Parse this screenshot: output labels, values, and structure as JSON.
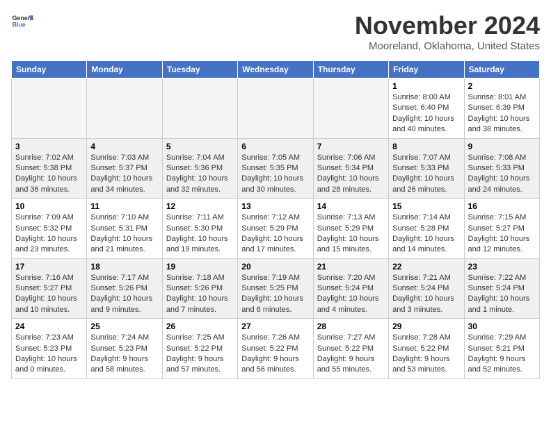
{
  "header": {
    "logo_line1": "General",
    "logo_line2": "Blue",
    "month": "November 2024",
    "location": "Mooreland, Oklahoma, United States"
  },
  "weekdays": [
    "Sunday",
    "Monday",
    "Tuesday",
    "Wednesday",
    "Thursday",
    "Friday",
    "Saturday"
  ],
  "weeks": [
    [
      {
        "day": "",
        "info": ""
      },
      {
        "day": "",
        "info": ""
      },
      {
        "day": "",
        "info": ""
      },
      {
        "day": "",
        "info": ""
      },
      {
        "day": "",
        "info": ""
      },
      {
        "day": "1",
        "info": "Sunrise: 8:00 AM\nSunset: 6:40 PM\nDaylight: 10 hours\nand 40 minutes."
      },
      {
        "day": "2",
        "info": "Sunrise: 8:01 AM\nSunset: 6:39 PM\nDaylight: 10 hours\nand 38 minutes."
      }
    ],
    [
      {
        "day": "3",
        "info": "Sunrise: 7:02 AM\nSunset: 5:38 PM\nDaylight: 10 hours\nand 36 minutes."
      },
      {
        "day": "4",
        "info": "Sunrise: 7:03 AM\nSunset: 5:37 PM\nDaylight: 10 hours\nand 34 minutes."
      },
      {
        "day": "5",
        "info": "Sunrise: 7:04 AM\nSunset: 5:36 PM\nDaylight: 10 hours\nand 32 minutes."
      },
      {
        "day": "6",
        "info": "Sunrise: 7:05 AM\nSunset: 5:35 PM\nDaylight: 10 hours\nand 30 minutes."
      },
      {
        "day": "7",
        "info": "Sunrise: 7:06 AM\nSunset: 5:34 PM\nDaylight: 10 hours\nand 28 minutes."
      },
      {
        "day": "8",
        "info": "Sunrise: 7:07 AM\nSunset: 5:33 PM\nDaylight: 10 hours\nand 26 minutes."
      },
      {
        "day": "9",
        "info": "Sunrise: 7:08 AM\nSunset: 5:33 PM\nDaylight: 10 hours\nand 24 minutes."
      }
    ],
    [
      {
        "day": "10",
        "info": "Sunrise: 7:09 AM\nSunset: 5:32 PM\nDaylight: 10 hours\nand 23 minutes."
      },
      {
        "day": "11",
        "info": "Sunrise: 7:10 AM\nSunset: 5:31 PM\nDaylight: 10 hours\nand 21 minutes."
      },
      {
        "day": "12",
        "info": "Sunrise: 7:11 AM\nSunset: 5:30 PM\nDaylight: 10 hours\nand 19 minutes."
      },
      {
        "day": "13",
        "info": "Sunrise: 7:12 AM\nSunset: 5:29 PM\nDaylight: 10 hours\nand 17 minutes."
      },
      {
        "day": "14",
        "info": "Sunrise: 7:13 AM\nSunset: 5:29 PM\nDaylight: 10 hours\nand 15 minutes."
      },
      {
        "day": "15",
        "info": "Sunrise: 7:14 AM\nSunset: 5:28 PM\nDaylight: 10 hours\nand 14 minutes."
      },
      {
        "day": "16",
        "info": "Sunrise: 7:15 AM\nSunset: 5:27 PM\nDaylight: 10 hours\nand 12 minutes."
      }
    ],
    [
      {
        "day": "17",
        "info": "Sunrise: 7:16 AM\nSunset: 5:27 PM\nDaylight: 10 hours\nand 10 minutes."
      },
      {
        "day": "18",
        "info": "Sunrise: 7:17 AM\nSunset: 5:26 PM\nDaylight: 10 hours\nand 9 minutes."
      },
      {
        "day": "19",
        "info": "Sunrise: 7:18 AM\nSunset: 5:26 PM\nDaylight: 10 hours\nand 7 minutes."
      },
      {
        "day": "20",
        "info": "Sunrise: 7:19 AM\nSunset: 5:25 PM\nDaylight: 10 hours\nand 6 minutes."
      },
      {
        "day": "21",
        "info": "Sunrise: 7:20 AM\nSunset: 5:24 PM\nDaylight: 10 hours\nand 4 minutes."
      },
      {
        "day": "22",
        "info": "Sunrise: 7:21 AM\nSunset: 5:24 PM\nDaylight: 10 hours\nand 3 minutes."
      },
      {
        "day": "23",
        "info": "Sunrise: 7:22 AM\nSunset: 5:24 PM\nDaylight: 10 hours\nand 1 minute."
      }
    ],
    [
      {
        "day": "24",
        "info": "Sunrise: 7:23 AM\nSunset: 5:23 PM\nDaylight: 10 hours\nand 0 minutes."
      },
      {
        "day": "25",
        "info": "Sunrise: 7:24 AM\nSunset: 5:23 PM\nDaylight: 9 hours\nand 58 minutes."
      },
      {
        "day": "26",
        "info": "Sunrise: 7:25 AM\nSunset: 5:22 PM\nDaylight: 9 hours\nand 57 minutes."
      },
      {
        "day": "27",
        "info": "Sunrise: 7:26 AM\nSunset: 5:22 PM\nDaylight: 9 hours\nand 56 minutes."
      },
      {
        "day": "28",
        "info": "Sunrise: 7:27 AM\nSunset: 5:22 PM\nDaylight: 9 hours\nand 55 minutes."
      },
      {
        "day": "29",
        "info": "Sunrise: 7:28 AM\nSunset: 5:22 PM\nDaylight: 9 hours\nand 53 minutes."
      },
      {
        "day": "30",
        "info": "Sunrise: 7:29 AM\nSunset: 5:21 PM\nDaylight: 9 hours\nand 52 minutes."
      }
    ]
  ]
}
